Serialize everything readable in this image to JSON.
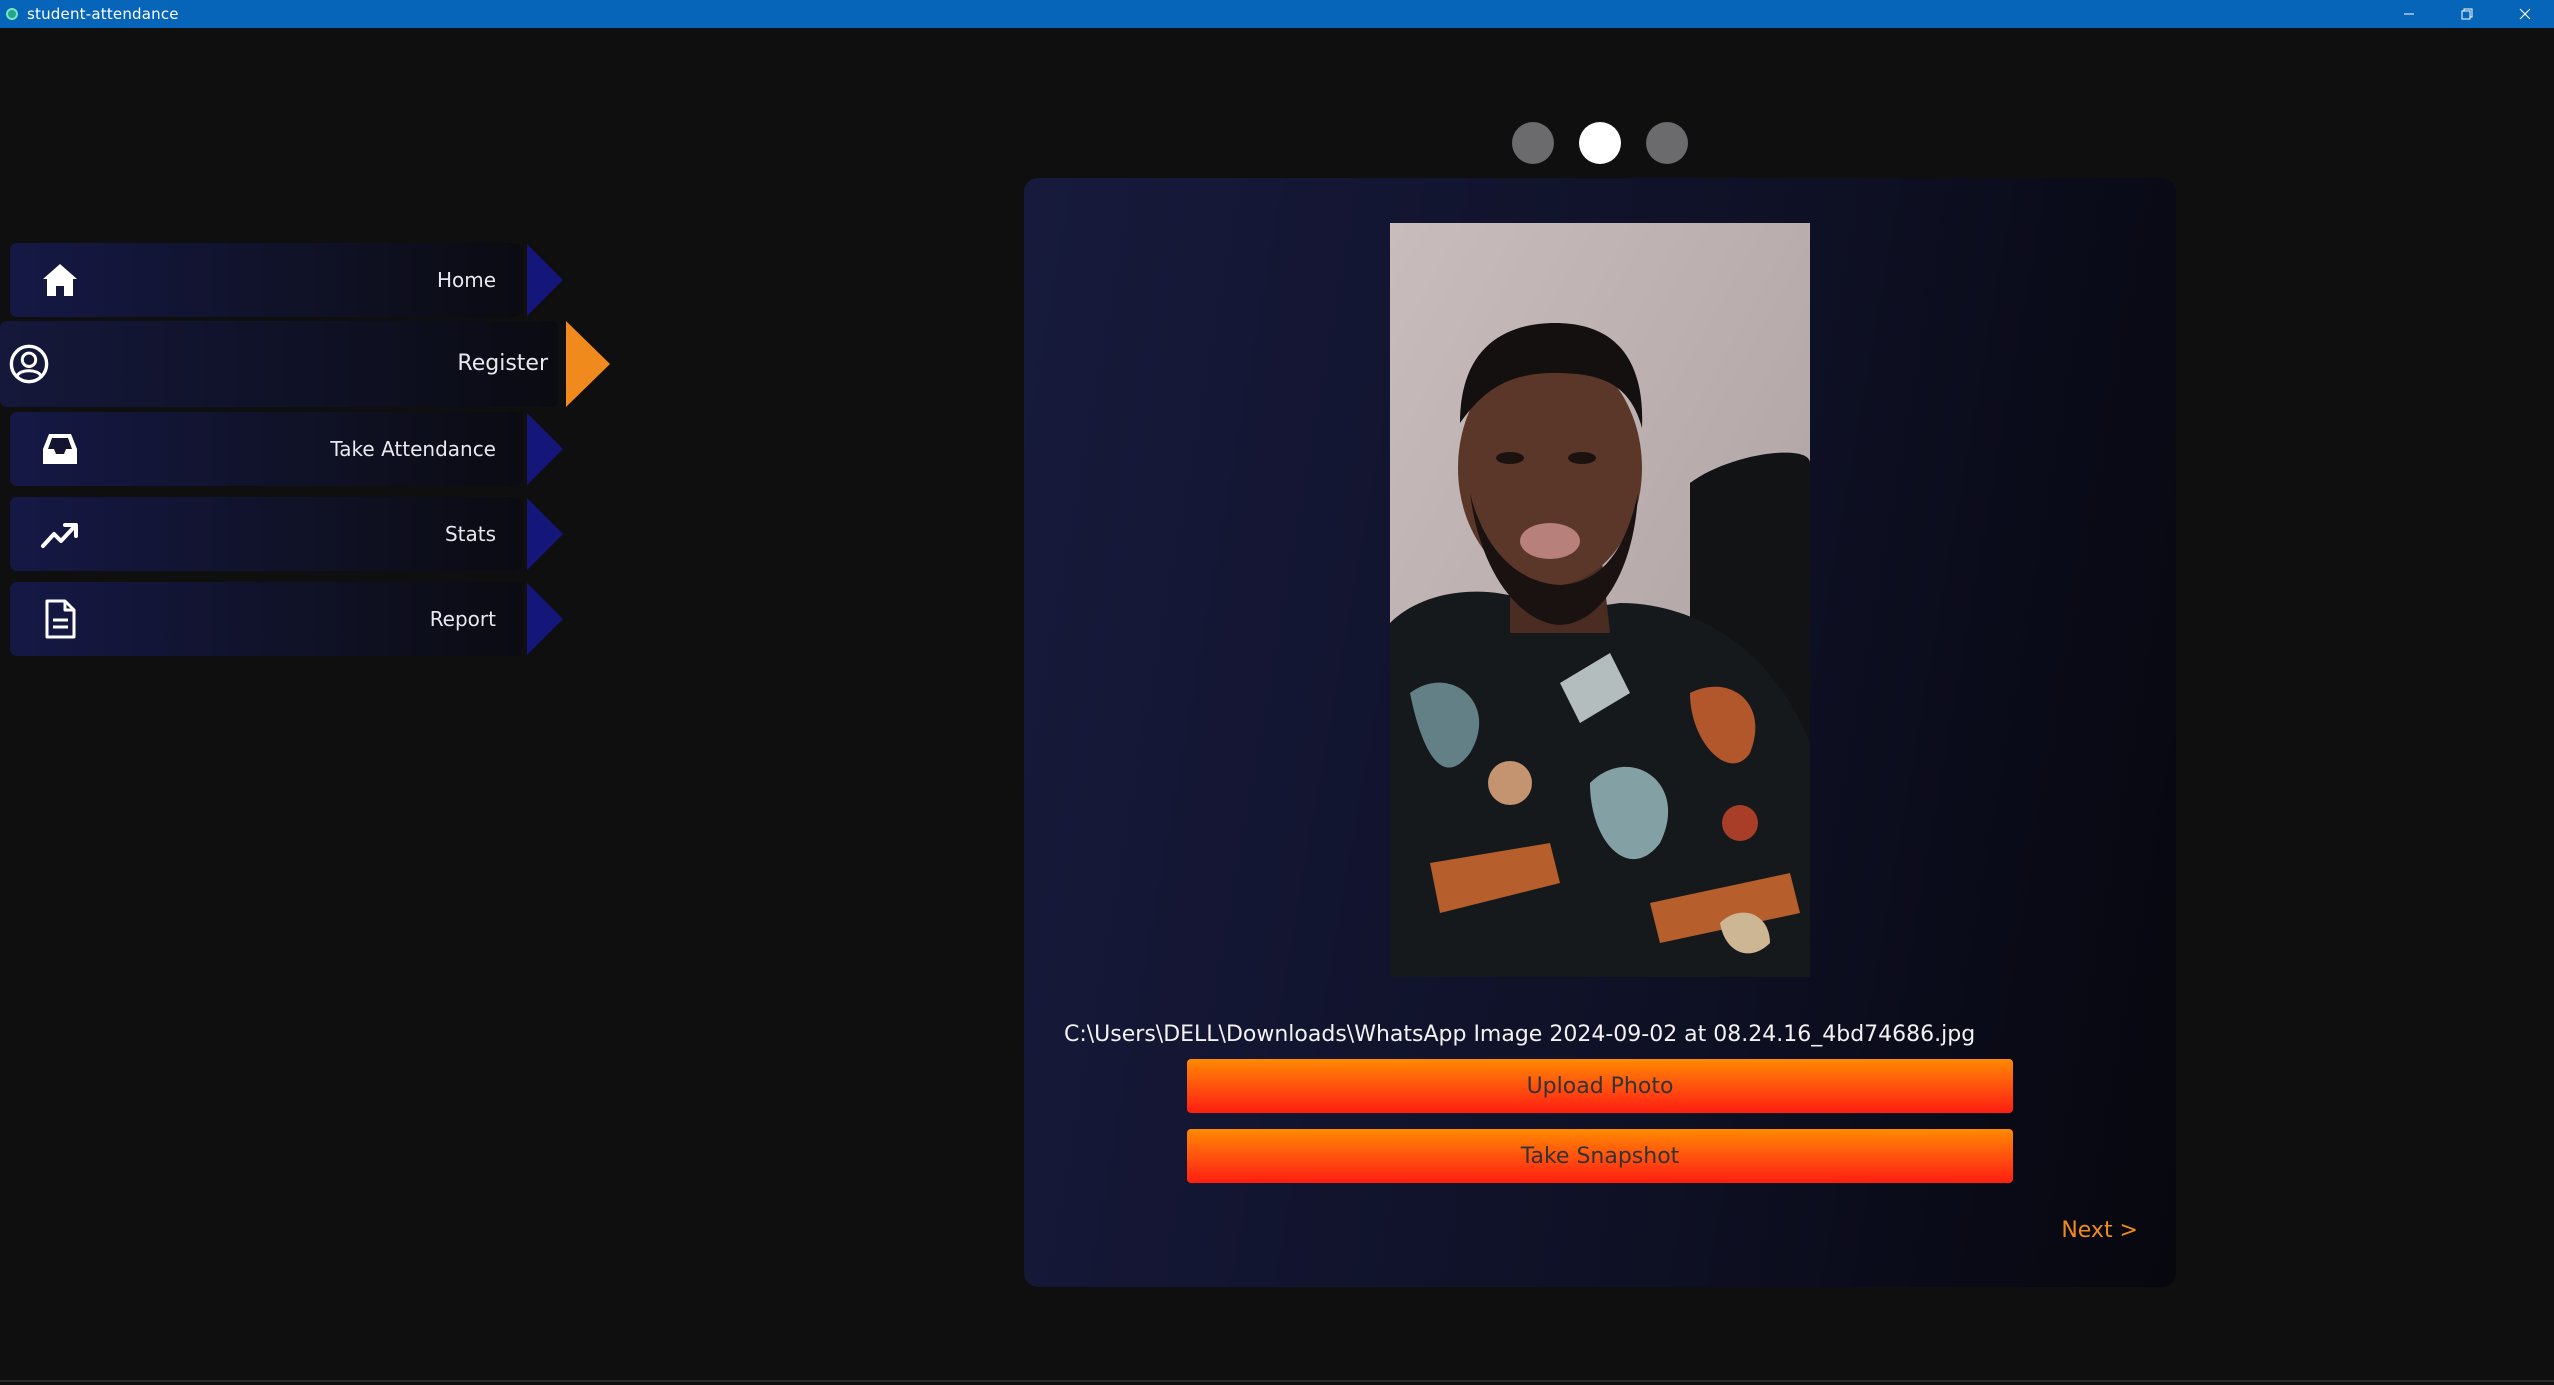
{
  "window": {
    "title": "student-attendance",
    "controls": [
      "minimize",
      "restore",
      "close"
    ]
  },
  "sidebar": {
    "items": [
      {
        "label": "Home",
        "icon": "home-icon",
        "active": false
      },
      {
        "label": "Register",
        "icon": "user-circle-icon",
        "active": true
      },
      {
        "label": "Take Attendance",
        "icon": "inbox-tray-icon",
        "active": false
      },
      {
        "label": "Stats",
        "icon": "trending-up-icon",
        "active": false
      },
      {
        "label": "Report",
        "icon": "document-icon",
        "active": false
      }
    ]
  },
  "stepper": {
    "total": 3,
    "current": 2
  },
  "registration": {
    "file_path": "C:\\Users\\DELL\\Downloads\\WhatsApp Image 2024-09-02 at 08.24.16_4bd74686.jpg",
    "upload_label": "Upload Photo",
    "snapshot_label": "Take Snapshot",
    "next_label": "Next >"
  },
  "colors": {
    "titlebar": "#0665b8",
    "accent": "#f08a1c",
    "nav_arrow": "#14167a",
    "button_gradient_top": "#ff8a00",
    "button_gradient_bottom": "#ff1e10",
    "background": "#0f0f10"
  }
}
